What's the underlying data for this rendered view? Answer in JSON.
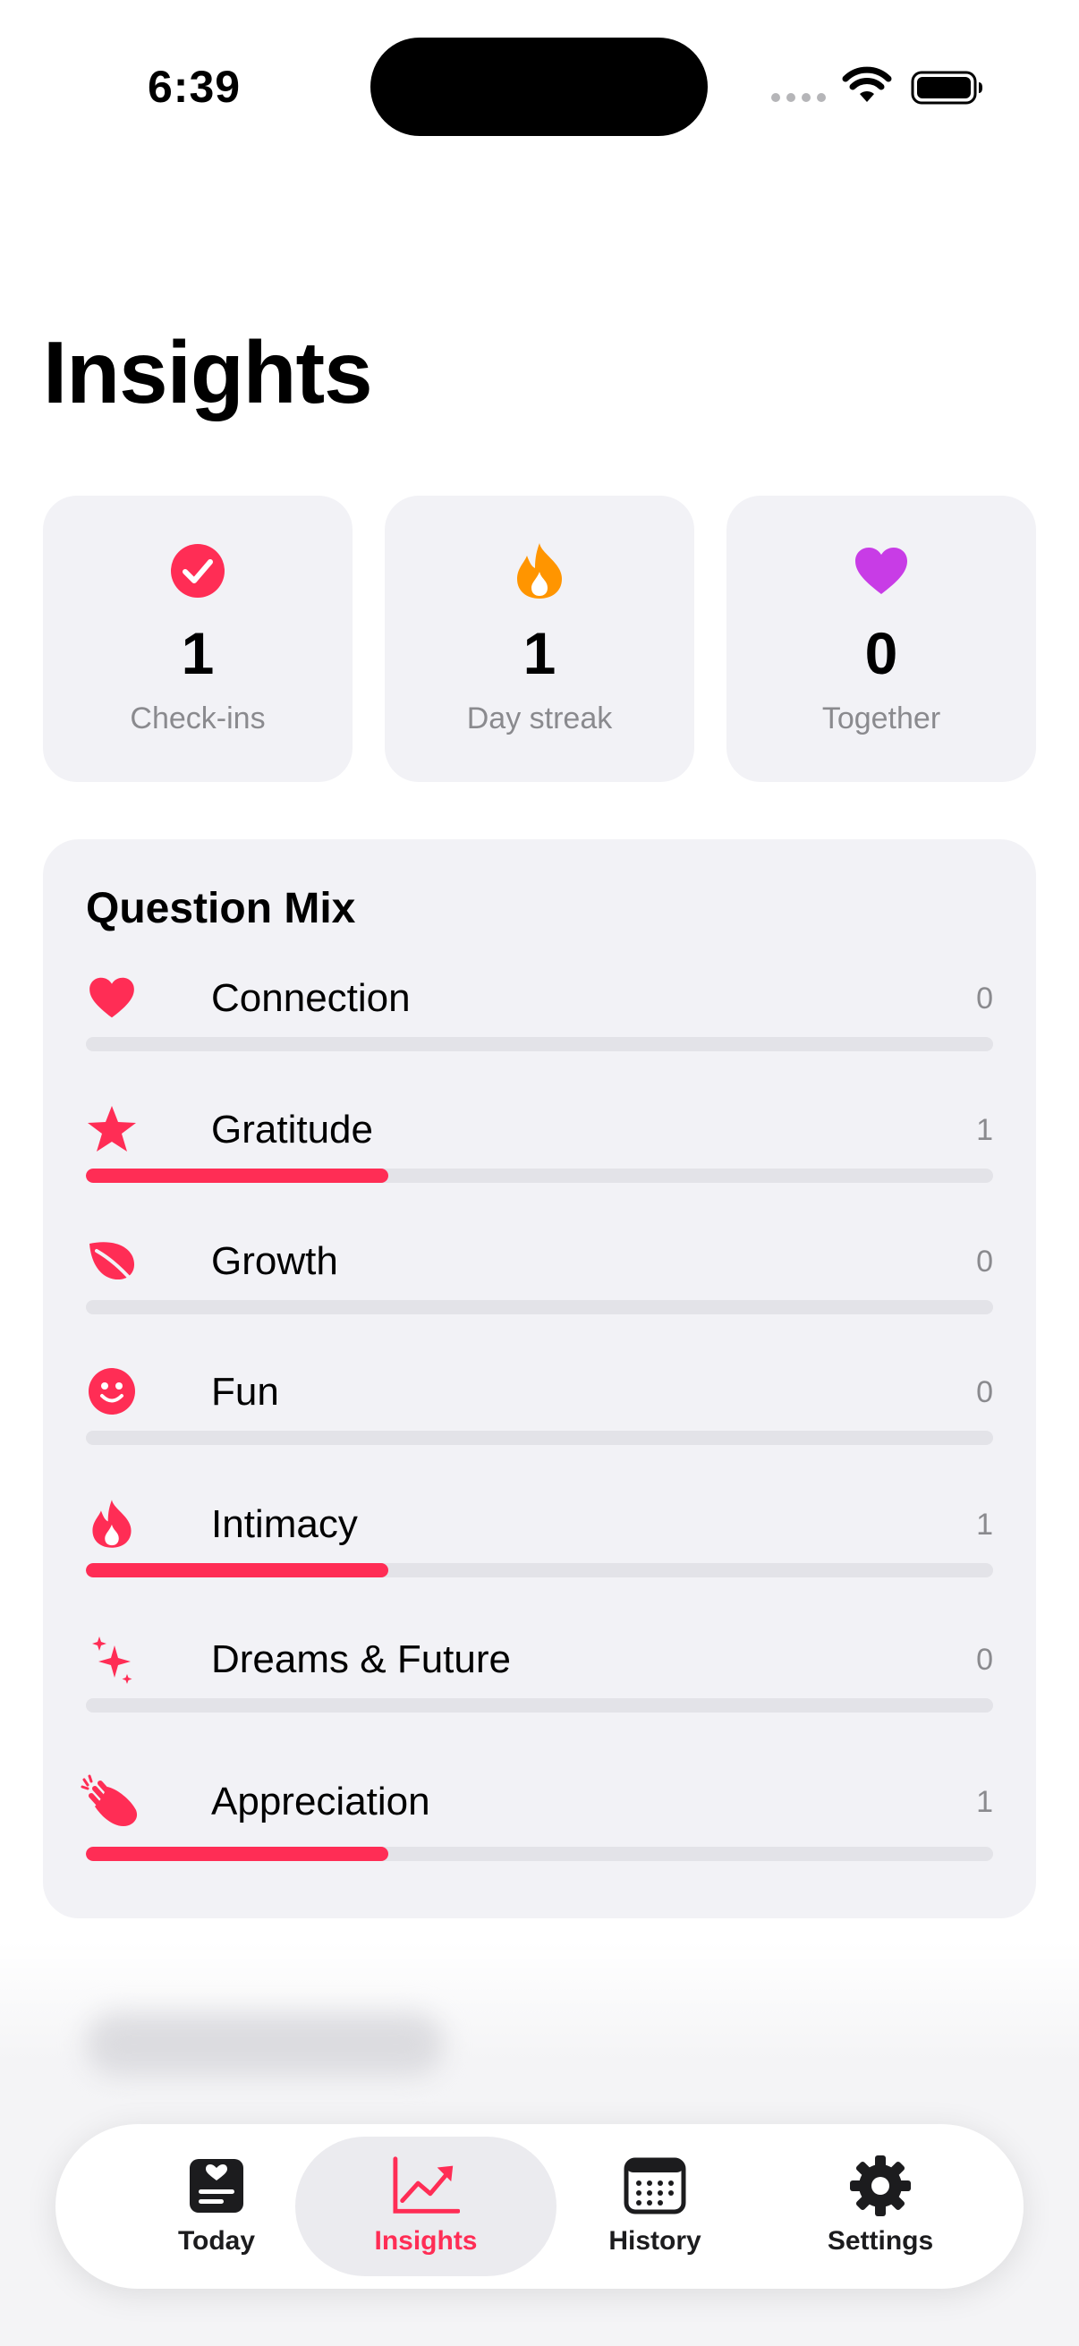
{
  "status_bar": {
    "time": "6:39"
  },
  "page": {
    "title": "Insights"
  },
  "stats": [
    {
      "value": "1",
      "label": "Check-ins",
      "icon": "checkmark-circle-icon",
      "color": "#ff2d55"
    },
    {
      "value": "1",
      "label": "Day streak",
      "icon": "flame-icon",
      "color": "#ff9500"
    },
    {
      "value": "0",
      "label": "Together",
      "icon": "heart-icon",
      "color": "#c83ce6"
    }
  ],
  "question_mix": {
    "title": "Question Mix",
    "accent": "#ff2d55",
    "max": 3,
    "items": [
      {
        "label": "Connection",
        "count": "0",
        "value": 0,
        "icon": "heart-icon"
      },
      {
        "label": "Gratitude",
        "count": "1",
        "value": 1,
        "icon": "star-icon"
      },
      {
        "label": "Growth",
        "count": "0",
        "value": 0,
        "icon": "leaf-icon"
      },
      {
        "label": "Fun",
        "count": "0",
        "value": 0,
        "icon": "smiley-icon"
      },
      {
        "label": "Intimacy",
        "count": "1",
        "value": 1,
        "icon": "flame-icon"
      },
      {
        "label": "Dreams & Future",
        "count": "0",
        "value": 0,
        "icon": "sparkles-icon"
      },
      {
        "label": "Appreciation",
        "count": "1",
        "value": 1,
        "icon": "clapping-hands-icon"
      }
    ]
  },
  "tabs": [
    {
      "label": "Today",
      "icon": "today-card-icon",
      "active": false
    },
    {
      "label": "Insights",
      "icon": "chart-line-icon",
      "active": true
    },
    {
      "label": "History",
      "icon": "calendar-icon",
      "active": false
    },
    {
      "label": "Settings",
      "icon": "gear-icon",
      "active": false
    }
  ]
}
